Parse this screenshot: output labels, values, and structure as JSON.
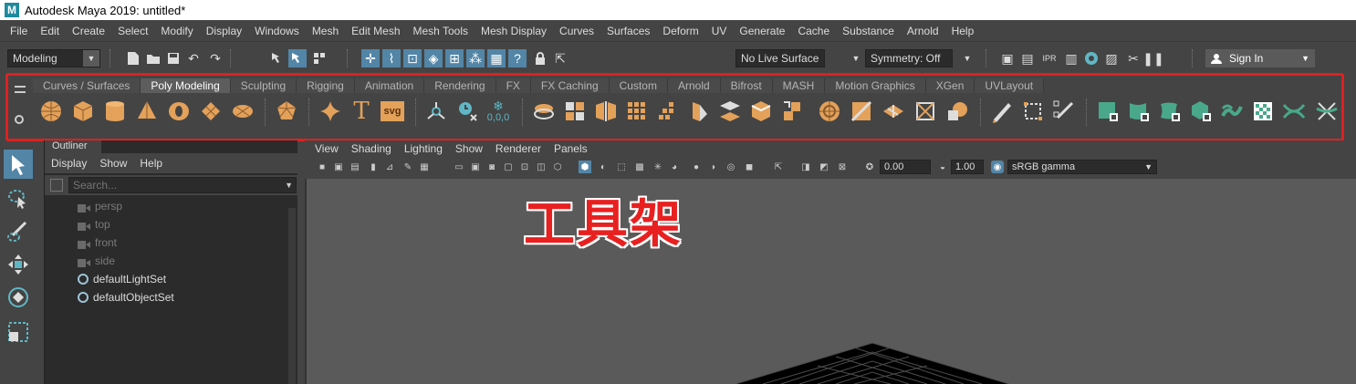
{
  "window": {
    "title": "Autodesk Maya 2019: untitled*",
    "logo_letter": "M"
  },
  "menubar": [
    "File",
    "Edit",
    "Create",
    "Select",
    "Modify",
    "Display",
    "Windows",
    "Mesh",
    "Edit Mesh",
    "Mesh Tools",
    "Mesh Display",
    "Curves",
    "Surfaces",
    "Deform",
    "UV",
    "Generate",
    "Cache",
    "Substance",
    "Arnold",
    "Help"
  ],
  "statusline": {
    "mode": "Modeling",
    "live_surface": "No Live Surface",
    "symmetry": "Symmetry: Off",
    "sign_in": "Sign In"
  },
  "shelf": {
    "tabs": [
      "Curves / Surfaces",
      "Poly Modeling",
      "Sculpting",
      "Rigging",
      "Animation",
      "Rendering",
      "FX",
      "FX Caching",
      "Custom",
      "Arnold",
      "Bifrost",
      "MASH",
      "Motion Graphics",
      "XGen",
      "UVLayout"
    ],
    "active_tab": "Poly Modeling",
    "text_icons": {
      "type_tool": "T",
      "svg_tool": "svg",
      "snow_value": "0,0,0"
    }
  },
  "annotation": {
    "text": "工具架",
    "color": "#e82020"
  },
  "outliner": {
    "tab_label": "Outliner",
    "menu": [
      "Display",
      "Show",
      "Help"
    ],
    "search_placeholder": "Search...",
    "items": [
      {
        "label": "persp",
        "kind": "camera",
        "dim": true
      },
      {
        "label": "top",
        "kind": "camera",
        "dim": true
      },
      {
        "label": "front",
        "kind": "camera",
        "dim": true
      },
      {
        "label": "side",
        "kind": "camera",
        "dim": true
      },
      {
        "label": "defaultLightSet",
        "kind": "set",
        "dim": false
      },
      {
        "label": "defaultObjectSet",
        "kind": "set",
        "dim": false
      }
    ]
  },
  "viewport": {
    "menu": [
      "View",
      "Shading",
      "Lighting",
      "Show",
      "Renderer",
      "Panels"
    ],
    "exposure": "0.00",
    "gamma": "1.00",
    "color_space": "sRGB gamma"
  },
  "colors": {
    "accent": "#5285a6",
    "shelf_orange": "#e3a15a",
    "shelf_green": "#4aa88a",
    "highlight": "#e02020"
  }
}
